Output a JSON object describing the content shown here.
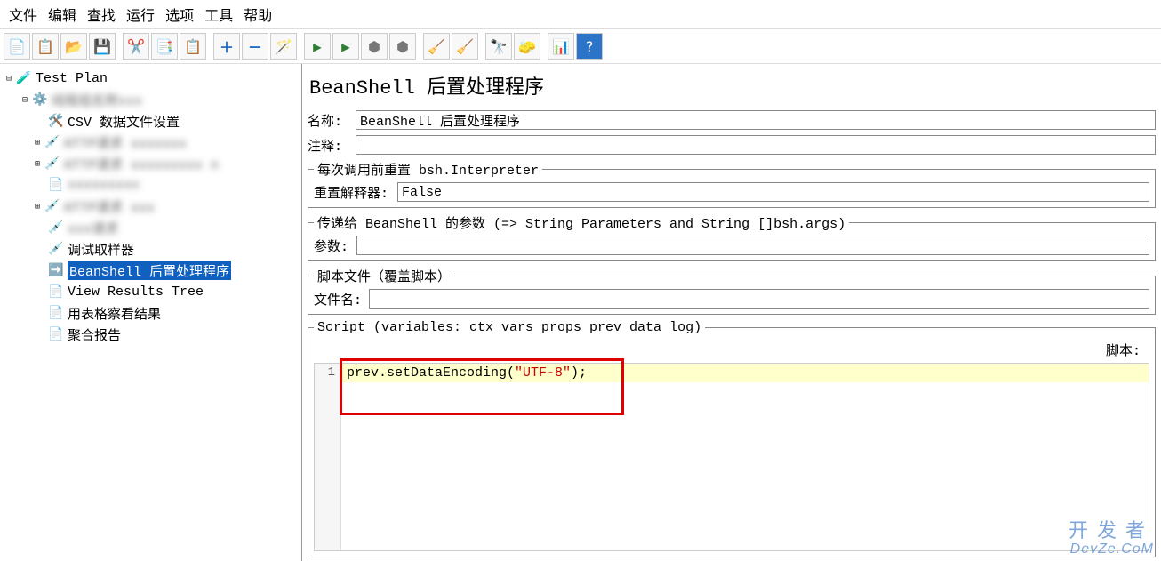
{
  "menu": {
    "file": "文件",
    "edit": "编辑",
    "search": "查找",
    "run": "运行",
    "options": "选项",
    "tools": "工具",
    "help": "帮助"
  },
  "tree": {
    "root": "Test Plan",
    "csv": "CSV 数据文件设置",
    "debug": "调试取样器",
    "beanshell": "BeanShell 后置处理程序",
    "viewtree": "View Results Tree",
    "tableview": "用表格察看结果",
    "aggregate": "聚合报告"
  },
  "panel": {
    "title": "BeanShell 后置处理程序",
    "name_label": "名称:",
    "name_value": "BeanShell 后置处理程序",
    "comment_label": "注释:",
    "comment_value": "",
    "reset_legend": "每次调用前重置 bsh.Interpreter",
    "reset_label": "重置解释器:",
    "reset_value": "False",
    "params_legend": "传递给 BeanShell 的参数 (=> String Parameters and String []bsh.args)",
    "params_label": "参数:",
    "params_value": "",
    "file_legend": "脚本文件（覆盖脚本）",
    "file_label": "文件名:",
    "file_value": "",
    "script_legend": "Script (variables: ctx vars props prev data log)",
    "script_header": "脚本:"
  },
  "code": {
    "line1_pre": "prev.setDataEncoding(",
    "line1_str": "\"UTF-8\"",
    "line1_post": ");"
  },
  "gutter": {
    "line1": "1"
  },
  "watermark": {
    "l1": "开发者",
    "l2": "DevZe.CoM"
  }
}
